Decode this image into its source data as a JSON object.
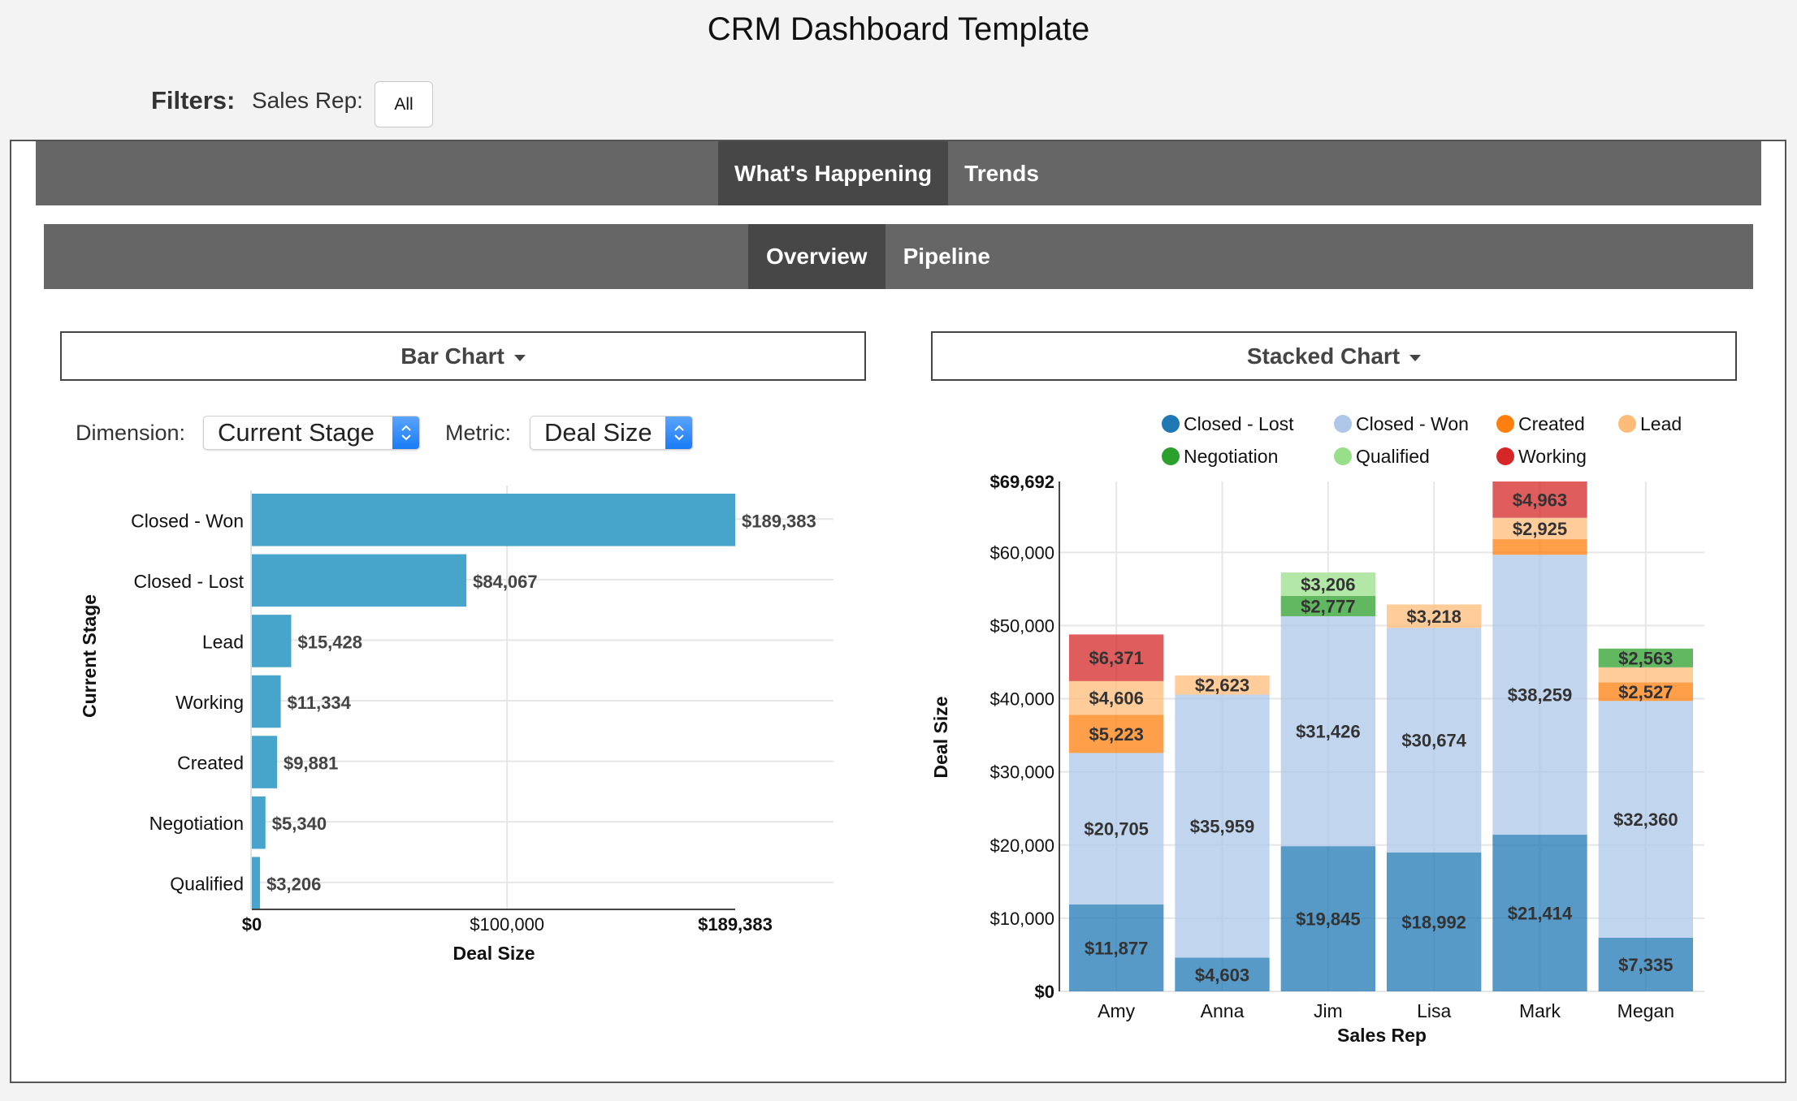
{
  "page": {
    "title": "CRM Dashboard Template",
    "filters_label": "Filters:",
    "sales_rep_label": "Sales Rep:",
    "sales_rep_value": "All"
  },
  "main_tabs": [
    {
      "label": "What's Happening",
      "active": true
    },
    {
      "label": "Trends",
      "active": false
    }
  ],
  "sub_tabs": [
    {
      "label": "Overview",
      "active": true
    },
    {
      "label": "Pipeline",
      "active": false
    }
  ],
  "left_panel": {
    "header": "Bar Chart",
    "dimension_label": "Dimension:",
    "dimension_value": "Current Stage",
    "metric_label": "Metric:",
    "metric_value": "Deal Size"
  },
  "right_panel": {
    "header": "Stacked Chart"
  },
  "colors": {
    "bar": "#43a2ca",
    "tab_bg": "#666666",
    "tab_active": "#474747",
    "select_accent": "#1a7cf5"
  },
  "chart_data": [
    {
      "type": "bar",
      "orientation": "horizontal",
      "categories": [
        "Closed - Won",
        "Closed - Lost",
        "Lead",
        "Working",
        "Created",
        "Negotiation",
        "Qualified"
      ],
      "values": [
        189383,
        84067,
        15428,
        11334,
        9881,
        5340,
        3206
      ],
      "data_labels": [
        "$189,383",
        "$84,067",
        "$15,428",
        "$11,334",
        "$9,881",
        "$5,340",
        "$3,206"
      ],
      "xlabel": "Deal Size",
      "ylabel": "Current Stage",
      "xlim": [
        0,
        189383
      ],
      "x_ticks": [
        {
          "value": 0,
          "label": "$0",
          "bold": true
        },
        {
          "value": 100000,
          "label": "$100,000",
          "bold": false
        },
        {
          "value": 189383,
          "label": "$189,383",
          "bold": true
        }
      ],
      "grid": true
    },
    {
      "type": "bar",
      "stacked": true,
      "categories": [
        "Amy",
        "Anna",
        "Jim",
        "Lisa",
        "Mark",
        "Megan"
      ],
      "xlabel": "Sales Rep",
      "ylabel": "Deal Size",
      "ylim": [
        0,
        69692
      ],
      "y_ticks": [
        {
          "value": 0,
          "label": "$0",
          "bold": true
        },
        {
          "value": 10000,
          "label": "$10,000",
          "bold": false
        },
        {
          "value": 20000,
          "label": "$20,000",
          "bold": false
        },
        {
          "value": 30000,
          "label": "$30,000",
          "bold": false
        },
        {
          "value": 40000,
          "label": "$40,000",
          "bold": false
        },
        {
          "value": 50000,
          "label": "$50,000",
          "bold": false
        },
        {
          "value": 60000,
          "label": "$60,000",
          "bold": false
        },
        {
          "value": 69692,
          "label": "$69,692",
          "bold": true
        }
      ],
      "legend_position": "top",
      "series": [
        {
          "name": "Closed - Lost",
          "color": "#1f77b4",
          "values": [
            11877,
            4603,
            19845,
            18992,
            21414,
            7335
          ]
        },
        {
          "name": "Closed - Won",
          "color": "#aec7e8",
          "values": [
            20705,
            35959,
            31426,
            30674,
            38259,
            32360
          ]
        },
        {
          "name": "Created",
          "color": "#ff7f0e",
          "values": [
            5223,
            0,
            0,
            0,
            2131,
            2527
          ]
        },
        {
          "name": "Lead",
          "color": "#ffbb78",
          "values": [
            4606,
            2623,
            0,
            3218,
            2925,
            2070
          ]
        },
        {
          "name": "Negotiation",
          "color": "#2ca02c",
          "values": [
            0,
            0,
            2777,
            0,
            0,
            2563
          ]
        },
        {
          "name": "Qualified",
          "color": "#98df8a",
          "values": [
            0,
            0,
            3206,
            0,
            0,
            0
          ]
        },
        {
          "name": "Working",
          "color": "#d62728",
          "values": [
            6371,
            0,
            0,
            0,
            4963,
            0
          ]
        }
      ],
      "labeled_min_value": 2300,
      "grid": true
    }
  ]
}
